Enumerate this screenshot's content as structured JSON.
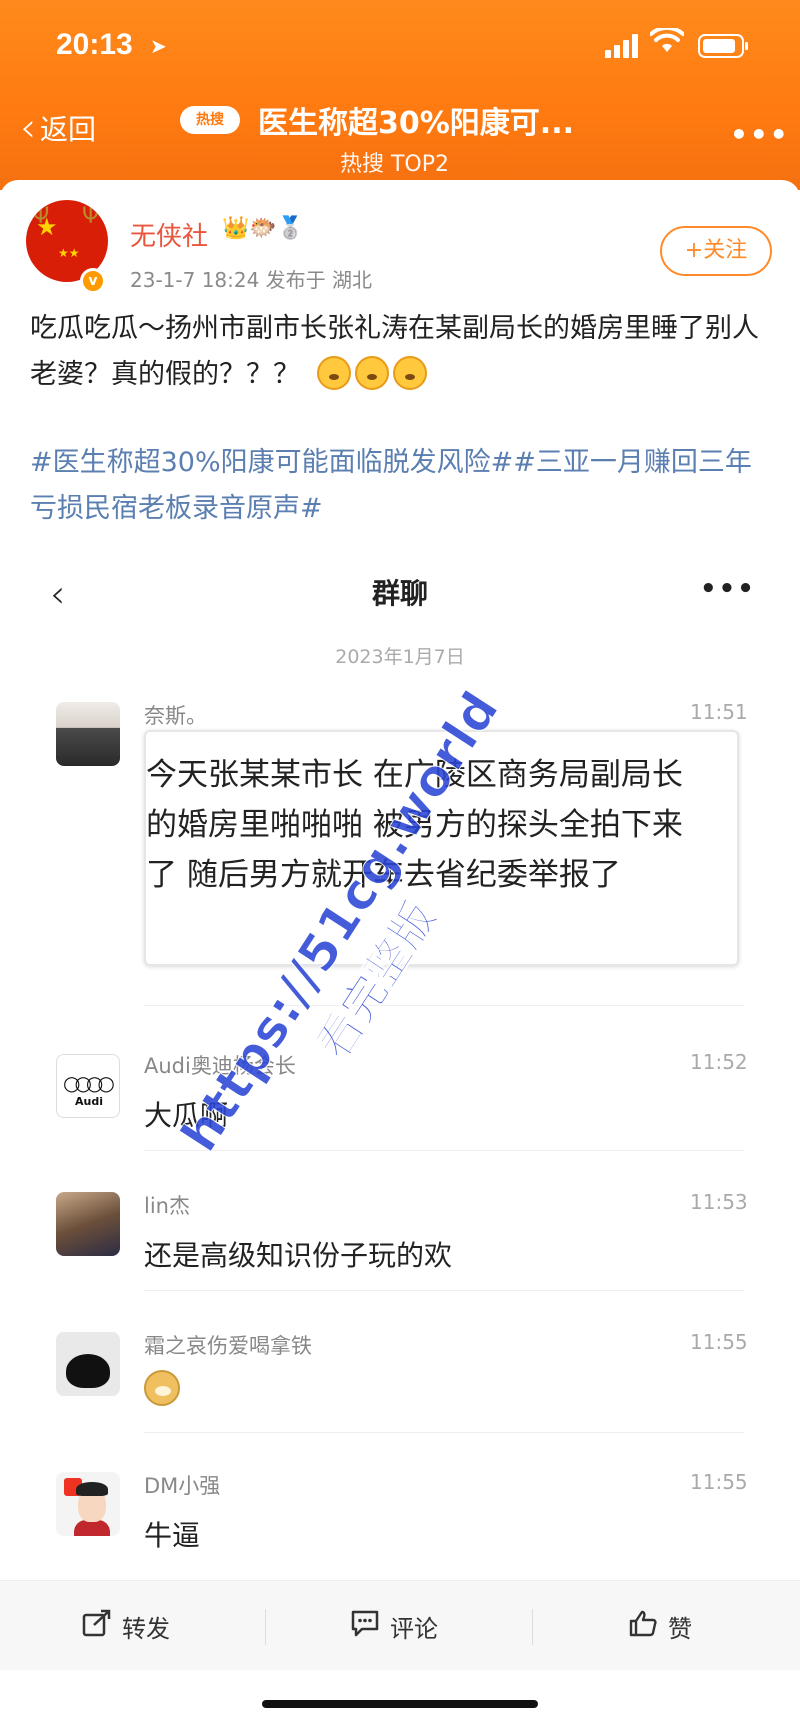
{
  "status_bar": {
    "time": "20:13"
  },
  "nav": {
    "back_label": "返回",
    "hot_badge": "热搜",
    "topic_title": "医生称超30%阳康可...",
    "topic_subtitle": "热搜 TOP2"
  },
  "post": {
    "username": "无侠社",
    "meta": "23-1-7 18:24  发布于 湖北",
    "follow_label": "+关注",
    "text": "吃瓜吃瓜～扬州市副市长张礼涛在某副局长的婚房里睡了别人老婆？真的假的？？？",
    "tags": "#医生称超30%阳康可能面临脱发风险##三亚一月赚回三年亏损民宿老板录音原声#"
  },
  "chat": {
    "title": "群聊",
    "date": "2023年1月7日",
    "messages": [
      {
        "name": "奈斯。",
        "time": "11:51",
        "text": "今天张某某市长 在广陵区商务局副局长 的婚房里啪啪啪 被男方的探头全拍下来了 随后男方就开车去省纪委举报了"
      },
      {
        "name": "Audi奥迪杨会长",
        "time": "11:52",
        "text": "大瓜啊",
        "avatar_text": "Audi"
      },
      {
        "name": "lin杰",
        "time": "11:53",
        "text": "还是高级知识份子玩的欢"
      },
      {
        "name": "霜之哀伤爱喝拿铁",
        "time": "11:55",
        "text": ""
      },
      {
        "name": "DM小强",
        "time": "11:55",
        "text": "牛逼"
      }
    ]
  },
  "watermark": {
    "line1": "https://51cg.world",
    "line2": "看完整版"
  },
  "actions": {
    "repost": "转发",
    "comment": "评论",
    "like": "赞"
  }
}
